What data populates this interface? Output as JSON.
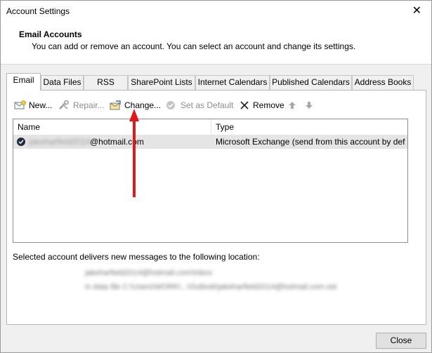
{
  "window": {
    "title": "Account Settings",
    "close_glyph": "✕"
  },
  "header": {
    "title": "Email Accounts",
    "subtitle": "You can add or remove an account. You can select an account and change its settings."
  },
  "tabs": [
    {
      "label": "Email",
      "active": true
    },
    {
      "label": "Data Files"
    },
    {
      "label": "RSS Feeds"
    },
    {
      "label": "SharePoint Lists"
    },
    {
      "label": "Internet Calendars"
    },
    {
      "label": "Published Calendars"
    },
    {
      "label": "Address Books"
    }
  ],
  "toolbar": {
    "new_label": "New...",
    "repair_label": "Repair...",
    "change_label": "Change...",
    "set_default_label": "Set as Default",
    "remove_label": "Remove"
  },
  "accounts": {
    "columns": {
      "name": "Name",
      "type": "Type"
    },
    "rows": [
      {
        "name_hidden": "jakeharfield2014",
        "name_visible": "@hotmail.com",
        "type": "Microsoft Exchange (send from this account by def..."
      }
    ]
  },
  "delivery": {
    "label": "Selected account delivers new messages to the following location:",
    "line1": "jakeharfield2014@hotmail.com\\Inbox",
    "line2": "in data file C:\\Users\\WORK\\...\\Outlook\\jakeharfield2014@hotmail.com.ost"
  },
  "footer": {
    "close_label": "Close"
  },
  "colors": {
    "annotation_arrow": "#e0191b",
    "selected_row": "#e5e5e5"
  }
}
